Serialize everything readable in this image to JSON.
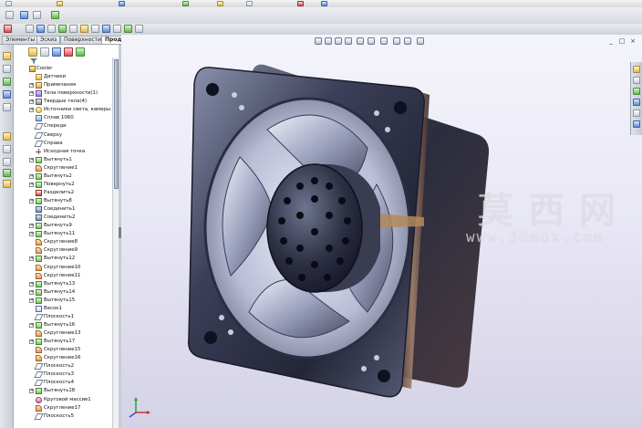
{
  "command_manager": {
    "tabs": [
      {
        "label": "Элементы",
        "active": false
      },
      {
        "label": "Эскиз",
        "active": false
      },
      {
        "label": "Поверхности",
        "active": false
      },
      {
        "label": "Продукты Office",
        "active": true
      }
    ]
  },
  "feature_tree": {
    "root": "Cooler",
    "items": [
      {
        "label": "Датчики",
        "icon": "sensor-folder-icon",
        "expandable": false
      },
      {
        "label": "Примечания",
        "icon": "annotations-icon",
        "expandable": true
      },
      {
        "label": "Тела поверхности(1)",
        "icon": "surface-bodies-icon",
        "expandable": true
      },
      {
        "label": "Твердые тела(4)",
        "icon": "solid-bodies-icon",
        "expandable": true
      },
      {
        "label": "Источники света, камеры и",
        "icon": "lights-cameras-icon",
        "expandable": true
      },
      {
        "label": "Сплав 1060",
        "icon": "material-icon",
        "expandable": false
      },
      {
        "label": "Спереди",
        "icon": "plane-icon",
        "expandable": false
      },
      {
        "label": "Сверху",
        "icon": "plane-icon",
        "expandable": false
      },
      {
        "label": "Справа",
        "icon": "plane-icon",
        "expandable": false
      },
      {
        "label": "Исходная точка",
        "icon": "origin-icon",
        "expandable": false
      },
      {
        "label": "Вытянуть1",
        "icon": "extrude-icon",
        "expandable": true
      },
      {
        "label": "Скругление1",
        "icon": "fillet-icon",
        "expandable": false
      },
      {
        "label": "Вытянуть2",
        "icon": "extrude-icon",
        "expandable": true
      },
      {
        "label": "Повернуть2",
        "icon": "revolve-icon",
        "expandable": true
      },
      {
        "label": "Разделить2",
        "icon": "split-icon",
        "expandable": false
      },
      {
        "label": "Вытянуть8",
        "icon": "extrude-icon",
        "expandable": true
      },
      {
        "label": "Соединить1",
        "icon": "combine-icon",
        "expandable": false
      },
      {
        "label": "Соединить2",
        "icon": "combine-icon",
        "expandable": false
      },
      {
        "label": "Вытянуть9",
        "icon": "extrude-icon",
        "expandable": true
      },
      {
        "label": "Вытянуть11",
        "icon": "extrude-icon",
        "expandable": true
      },
      {
        "label": "Скругление8",
        "icon": "fillet-icon",
        "expandable": false
      },
      {
        "label": "Скругление9",
        "icon": "fillet-icon",
        "expandable": false
      },
      {
        "label": "Вытянуть12",
        "icon": "extrude-icon",
        "expandable": true
      },
      {
        "label": "Скругление10",
        "icon": "fillet-icon",
        "expandable": false
      },
      {
        "label": "Скругление11",
        "icon": "fillet-icon",
        "expandable": false
      },
      {
        "label": "Вытянуть13",
        "icon": "extrude-icon",
        "expandable": true
      },
      {
        "label": "Вытянуть14",
        "icon": "extrude-icon",
        "expandable": true
      },
      {
        "label": "Вытянуть15",
        "icon": "extrude-icon",
        "expandable": true
      },
      {
        "label": "Весок1",
        "icon": "sketch-icon",
        "expandable": false
      },
      {
        "label": "Плоскость1",
        "icon": "plane-icon",
        "expandable": false
      },
      {
        "label": "Вытянуть16",
        "icon": "extrude-icon",
        "expandable": true
      },
      {
        "label": "Скругление13",
        "icon": "fillet-icon",
        "expandable": false
      },
      {
        "label": "Вытянуть17",
        "icon": "extrude-icon",
        "expandable": true
      },
      {
        "label": "Скругление15",
        "icon": "fillet-icon",
        "expandable": false
      },
      {
        "label": "Скругление16",
        "icon": "fillet-icon",
        "expandable": false
      },
      {
        "label": "Плоскость2",
        "icon": "plane-icon",
        "expandable": false
      },
      {
        "label": "Плоскость3",
        "icon": "plane-icon",
        "expandable": false
      },
      {
        "label": "Плоскость4",
        "icon": "plane-icon",
        "expandable": false
      },
      {
        "label": "Вытянуть18",
        "icon": "extrude-icon",
        "expandable": true
      },
      {
        "label": "Круговой массив1",
        "icon": "circular-pattern-icon",
        "expandable": false
      },
      {
        "label": "Скругление17",
        "icon": "fillet-icon",
        "expandable": false
      },
      {
        "label": "Плоскость5",
        "icon": "plane-icon",
        "expandable": false
      }
    ]
  },
  "viewport": {
    "watermark_cn": "莫西网",
    "watermark_url": "www.3dmox.com",
    "window_controls": [
      "_",
      "□",
      "×"
    ],
    "background_top": "#f4f4fb",
    "background_bottom": "#d4d2e6"
  }
}
